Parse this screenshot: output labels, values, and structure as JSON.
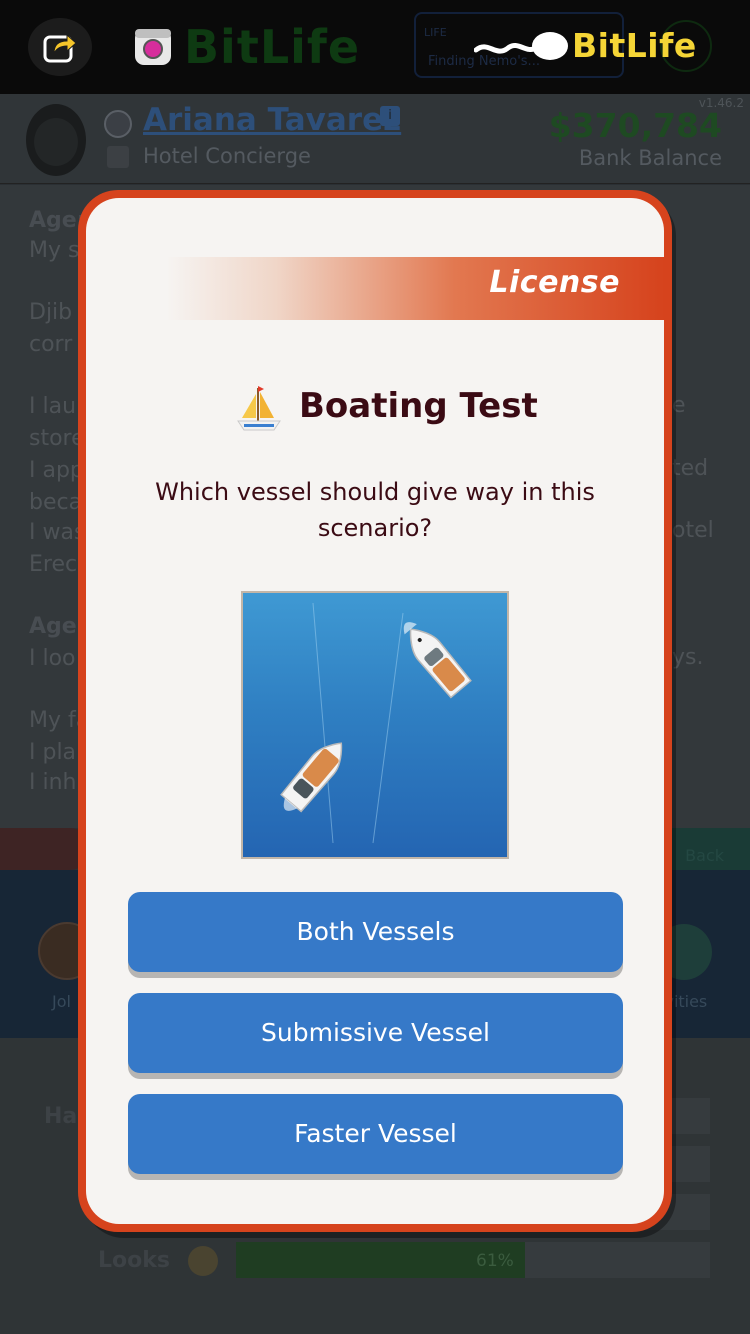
{
  "topbar": {
    "share_icon": "share-arrow-icon",
    "instagram_icon": "instagram-icon",
    "brand_name": "BitLife",
    "ghost_app_name": "BitLife",
    "ghost_box_title": "LIFE",
    "ghost_box_text": "Finding Nemo's..."
  },
  "character": {
    "name": "Ariana Tavarez",
    "info_badge": "i",
    "job": "Hotel Concierge",
    "version": "v1.46.2",
    "balance": "$370,784",
    "balance_label": "Bank Balance"
  },
  "log": {
    "lines": [
      {
        "text": "Age:",
        "bold": true
      },
      {
        "text": "My s",
        "bold": false
      },
      {
        "text": "Djib",
        "bold": false
      },
      {
        "text": "corr",
        "bold": false
      },
      {
        "text": "I lau",
        "bold": false
      },
      {
        "text": "store",
        "bold": false
      },
      {
        "text": "I app",
        "bold": false
      },
      {
        "text": "beca",
        "bold": false
      },
      {
        "text": "I was",
        "bold": false
      },
      {
        "text": "Erec",
        "bold": false
      },
      {
        "text": "Age:",
        "bold": true
      },
      {
        "text": "I loo",
        "bold": false
      },
      {
        "text": "My fa",
        "bold": false
      },
      {
        "text": "I pla",
        "bold": false
      },
      {
        "text": "I inh",
        "bold": false
      }
    ],
    "right_fragments": [
      "e",
      "ted",
      "otel",
      "ys."
    ]
  },
  "bottom": {
    "back_label": "Back",
    "left_action_label": "Jol",
    "right_action_label": "ivities",
    "stat_label": "Ha",
    "looks_label": "Looks",
    "looks_percent": "61%",
    "looks_value": 0.61
  },
  "modal": {
    "category": "License",
    "title_icon": "sailboat-icon",
    "title": "Boating Test",
    "question": "Which vessel should give way in this scenario?",
    "scene_image": "two-boats-crossing-illustration",
    "choices": [
      {
        "label": "Both Vessels"
      },
      {
        "label": "Submissive Vessel"
      },
      {
        "label": "Faster Vessel"
      }
    ]
  },
  "colors": {
    "modal_frame": "#d6431d",
    "choice_button": "#3679c8",
    "title_text": "#3b0b14",
    "brand_yellow": "#f5d536"
  }
}
